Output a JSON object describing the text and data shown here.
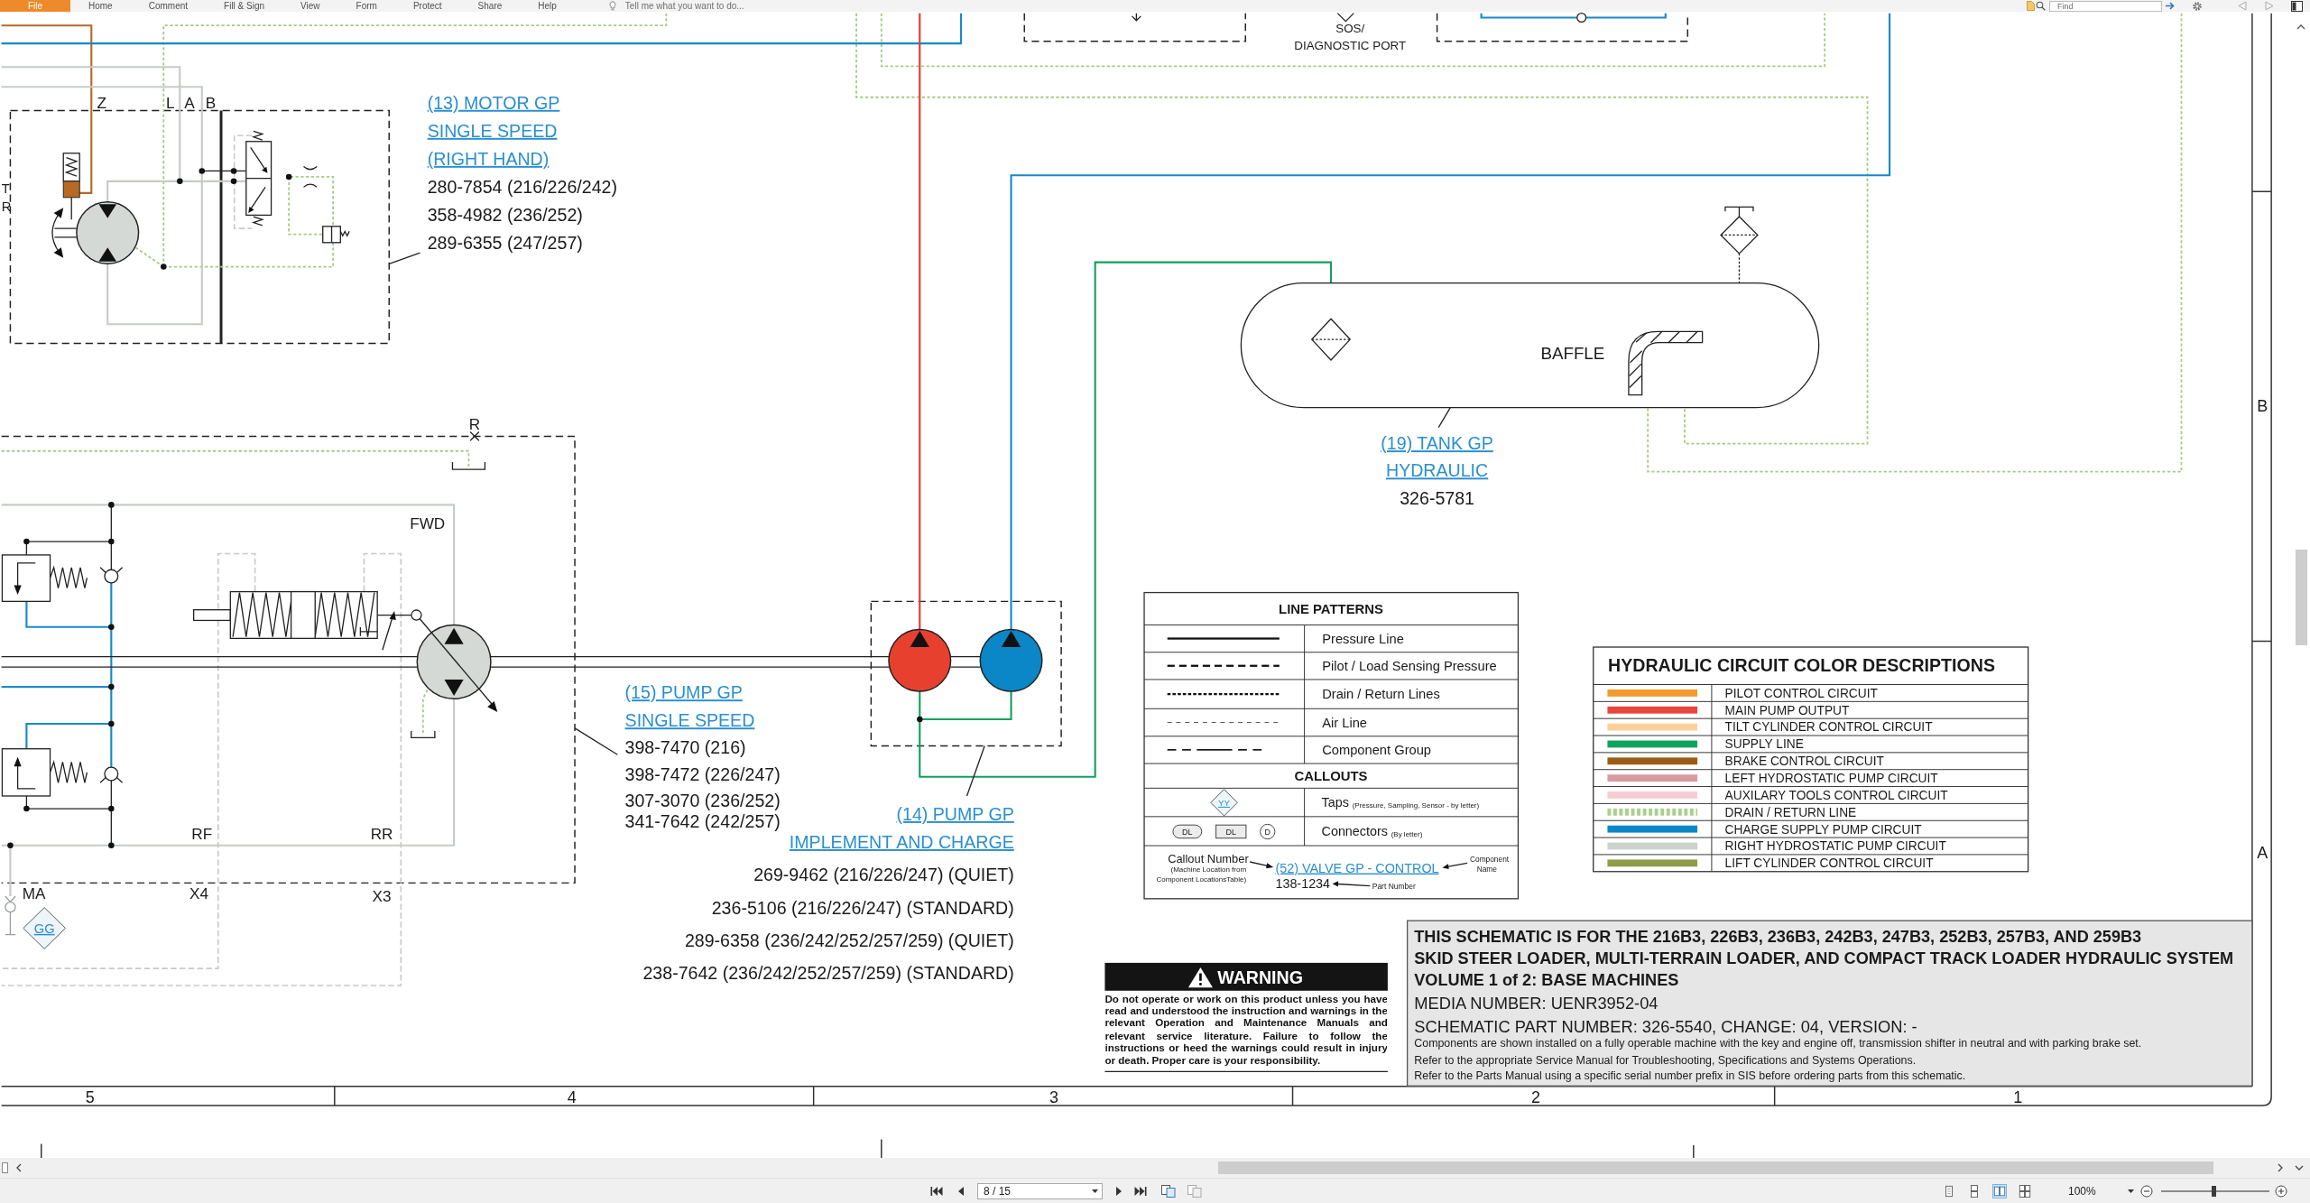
{
  "ribbon": {
    "file_button": "File",
    "tabs": [
      "Home",
      "Comment",
      "Fill & Sign",
      "View",
      "Form",
      "Protect",
      "Share",
      "Help"
    ],
    "tell_me": {
      "placeholder": "Tell me what you want to do..."
    },
    "find": {
      "placeholder": "Find"
    }
  },
  "schematic": {
    "diagnostic_port_label": [
      "SOS/",
      "DIAGNOSTIC PORT"
    ],
    "port_labels": [
      "T",
      "R",
      "Z",
      "L",
      "A",
      "B",
      "R",
      "FWD",
      "RF",
      "RR",
      "MA",
      "X4",
      "X3"
    ],
    "taps": [
      "GG"
    ],
    "baffle_label": "BAFFLE",
    "callouts": [
      {
        "title": [
          "(13) MOTOR GP",
          "SINGLE SPEED",
          "(RIGHT HAND)"
        ],
        "part_numbers": [
          "280-7854 (216/226/242)",
          "358-4982 (236/252)",
          "289-6355 (247/257)"
        ]
      },
      {
        "title": [
          "(15) PUMP GP",
          "SINGLE SPEED"
        ],
        "part_numbers": [
          "398-7470 (216)",
          "398-7472 (226/247)",
          "307-3070 (236/252)",
          "341-7642 (242/257)"
        ]
      },
      {
        "title": [
          "(14) PUMP GP",
          "IMPLEMENT AND CHARGE"
        ],
        "part_numbers": [
          "269-9462 (216/226/247) (QUIET)",
          "236-5106 (216/226/247) (STANDARD)",
          "289-6358 (236/242/252/257/259) (QUIET)",
          "238-7642 (236/242/252/257/259) (STANDARD)"
        ]
      },
      {
        "title": [
          "(19) TANK GP",
          "HYDRAULIC"
        ],
        "part_numbers": [
          "326-5781"
        ]
      }
    ]
  },
  "line_legend": {
    "title": "LINE PATTERNS",
    "rows": [
      {
        "kind": "pressure",
        "label": "Pressure Line"
      },
      {
        "kind": "pilot",
        "label": "Pilot / Load Sensing Pressure"
      },
      {
        "kind": "drain",
        "label": "Drain / Return Lines"
      },
      {
        "kind": "air",
        "label": "Air Line"
      },
      {
        "kind": "group",
        "label": "Component Group"
      }
    ],
    "callouts_title": "CALLOUTS",
    "taps": {
      "sample": "YY",
      "label": "Taps",
      "note": "(Pressure, Sampling, Sensor - by letter)"
    },
    "connectors": {
      "samples": [
        {
          "kind": "oval",
          "label": "DL"
        },
        {
          "kind": "square",
          "label": "DL"
        },
        {
          "kind": "circle",
          "label": "D"
        }
      ],
      "label": "Connectors",
      "note": "(By letter)"
    },
    "example": {
      "callout_number": "Callout Number",
      "callout_number_note": [
        "(Machine Location from",
        "Component LocationsTable)"
      ],
      "component": "(52) VALVE GP - CONTROL",
      "component_name": [
        "Component",
        "Name"
      ],
      "part_number": "138-1234",
      "part_number_label": "Part Number"
    }
  },
  "color_legend": {
    "title": "HYDRAULIC CIRCUIT COLOR DESCRIPTIONS",
    "rows": [
      {
        "kind": "solid",
        "color": "#f39a2c",
        "label": "PILOT CONTROL CIRCUIT"
      },
      {
        "kind": "solid",
        "color": "#e8453c",
        "label": "MAIN PUMP OUTPUT"
      },
      {
        "kind": "solid",
        "color": "#fcd09a",
        "label": "TILT CYLINDER CONTROL CIRCUIT"
      },
      {
        "kind": "solid",
        "color": "#10a35d",
        "label": "SUPPLY LINE"
      },
      {
        "kind": "solid",
        "color": "#9b5c16",
        "label": "BRAKE CONTROL CIRCUIT"
      },
      {
        "kind": "solid",
        "color": "#d99aa1",
        "label": "LEFT HYDROSTATIC PUMP CIRCUIT"
      },
      {
        "kind": "solid",
        "color": "#f8ccd5",
        "label": "AUXILARY TOOLS CONTROL CIRCUIT"
      },
      {
        "kind": "dashed",
        "color": "#a9d08e",
        "label": "DRAIN / RETURN LINE"
      },
      {
        "kind": "solid",
        "color": "#0b87c8",
        "label": "CHARGE SUPPLY PUMP CIRCUIT"
      },
      {
        "kind": "solid",
        "color": "#cbd3cb",
        "label": "RIGHT HYDROSTATIC PUMP CIRCUIT"
      },
      {
        "kind": "solid",
        "color": "#8f9c4b",
        "label": "LIFT CYLINDER CONTROL CIRCUIT"
      }
    ]
  },
  "warning": {
    "title": "WARNING",
    "text": "Do not operate or work on this product unless you have read and understood the instruction and warnings in the relevant Operation and Maintenance Manuals and relevant service literature. Failure to follow the instructions or heed the warnings could result in injury or death. Proper care is your responsibility."
  },
  "title_block": {
    "heading": [
      "THIS SCHEMATIC IS FOR THE 216B3, 226B3, 236B3, 242B3, 247B3, 252B3, 257B3, AND 259B3",
      "SKID STEER LOADER, MULTI-TERRAIN LOADER, AND COMPACT TRACK LOADER HYDRAULIC SYSTEM",
      "VOLUME 1 of 2: BASE MACHINES"
    ],
    "media_number": "MEDIA NUMBER: UENR3952-04",
    "part_number": "SCHEMATIC PART NUMBER: 326-5540, CHANGE: 04, VERSION: -",
    "notes": [
      "Components are shown installed on a fully operable machine with the key and engine off, transmission shifter in neutral and with parking brake set.",
      "Refer to the appropriate Service Manual for Troubleshooting, Specifications and Systems Operations.",
      "Refer to the Parts Manual using a specific serial number prefix in SIS before ordering parts from this schematic."
    ]
  },
  "border": {
    "rows": [
      "B",
      "A"
    ],
    "columns": [
      "5",
      "4",
      "3",
      "2",
      "1"
    ]
  },
  "status_bar": {
    "page_field": {
      "value": "8 / 15"
    },
    "view_modes": [
      {
        "selected": false
      },
      {
        "selected": false
      },
      {
        "selected": true
      },
      {
        "selected": false
      }
    ],
    "zoom_field": {
      "value": "100%"
    },
    "zoom_slider": {
      "level": 0.48
    }
  }
}
